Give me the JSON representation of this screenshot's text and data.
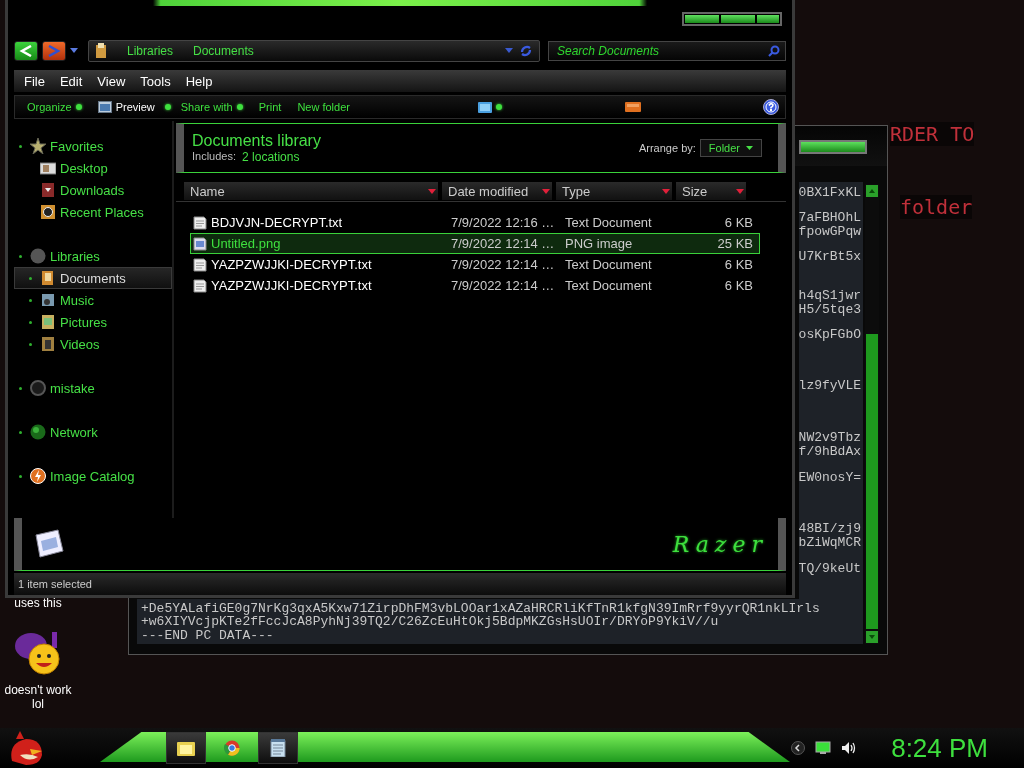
{
  "desktop": {
    "background_texts": [
      "RDER TO",
      "folder"
    ],
    "icon_labels": [
      {
        "label": "uses this"
      },
      {
        "label": "doesn't work lol",
        "kind": "messenger"
      }
    ]
  },
  "notepad": {
    "side_lines": [
      "0BX1FxKL",
      "7aFBHOhL",
      "fpowGPqw",
      "U7KrBt5x",
      "h4qS1jwr",
      "H5/5tqe3",
      "osKpFGbO",
      "lz9fyVLE",
      "NW2v9Tbz",
      "f/9hBdAx",
      "EW0nosY=",
      "48BI/zj9",
      "bZiWqMCR",
      "TQ/9keUt"
    ],
    "bottom_lines": [
      "+De5YALafiGE0g7NrKg3qxA5Kxw71ZirpDhFM3vbLOOar1xAZaHRCRliKfTnR1kfgN39ImRrf9yyrQR1nkLIrls",
      "+w6XIYVcjpKTe2fFccJcA8PyhNj39TQ2/C26ZcEuHtOkj5BdpMKZGsHsUOIr/DRYoP9YkiV//u",
      "---END PC DATA---"
    ]
  },
  "explorer": {
    "breadcrumb": [
      "Libraries",
      "Documents"
    ],
    "search": {
      "placeholder": "Search Documents"
    },
    "menu": [
      "File",
      "Edit",
      "View",
      "Tools",
      "Help"
    ],
    "toolbar": [
      {
        "label": "Organize",
        "kind": "menu"
      },
      {
        "label": "Preview",
        "kind": "preview"
      },
      {
        "label": "Share with",
        "kind": "menu"
      },
      {
        "label": "Print",
        "kind": "plain"
      },
      {
        "label": "New folder",
        "kind": "plain"
      }
    ],
    "sidebar": [
      {
        "label": "Favorites",
        "kind": "star",
        "selected": false,
        "children": [
          {
            "label": "Desktop",
            "kind": "desktop",
            "selected": false
          },
          {
            "label": "Downloads",
            "kind": "downloads",
            "selected": false
          },
          {
            "label": "Recent Places",
            "kind": "recent",
            "selected": false
          }
        ]
      },
      {
        "label": "Libraries",
        "kind": "libraries",
        "selected": false,
        "children": [
          {
            "label": "Documents",
            "kind": "documents",
            "selected": true
          },
          {
            "label": "Music",
            "kind": "music",
            "selected": false
          },
          {
            "label": "Pictures",
            "kind": "pictures",
            "selected": false
          },
          {
            "label": "Videos",
            "kind": "videos",
            "selected": false
          }
        ]
      },
      {
        "label": "mistake",
        "kind": "homegroup",
        "selected": false
      },
      {
        "label": "Network",
        "kind": "network",
        "selected": false
      },
      {
        "label": "Image Catalog",
        "kind": "catalog",
        "selected": false
      }
    ],
    "library": {
      "title": "Documents library",
      "includes_label": "Includes:",
      "locations": "2 locations",
      "arrange_label": "Arrange by:",
      "arrange_value": "Folder"
    },
    "columns": [
      "Name",
      "Date modified",
      "Type",
      "Size"
    ],
    "rows": [
      {
        "name": "BDJVJN-DECRYPT.txt",
        "date": "7/9/2022 12:16 …",
        "type": "Text Document",
        "size": "6 KB",
        "kind": "text",
        "selected": false
      },
      {
        "name": "Untitled.png",
        "date": "7/9/2022 12:14 …",
        "type": "PNG image",
        "size": "25 KB",
        "kind": "image",
        "selected": true
      },
      {
        "name": "YAZPZWJJKI-DECRYPT.txt",
        "date": "7/9/2022 12:14 …",
        "type": "Text Document",
        "size": "6 KB",
        "kind": "text",
        "selected": false
      },
      {
        "name": "YAZPZWJJKI-DECRYPT.txt",
        "date": "7/9/2022 12:14 …",
        "type": "Text Document",
        "size": "6 KB",
        "kind": "text",
        "selected": false
      }
    ],
    "logo_text": "Razer",
    "status": "1 item selected"
  },
  "taskbar": {
    "apps": [
      {
        "kind": "folder",
        "active": true
      },
      {
        "kind": "browser",
        "active": false
      },
      {
        "kind": "notepad",
        "active": true
      }
    ],
    "clock": "8:24 PM"
  }
}
